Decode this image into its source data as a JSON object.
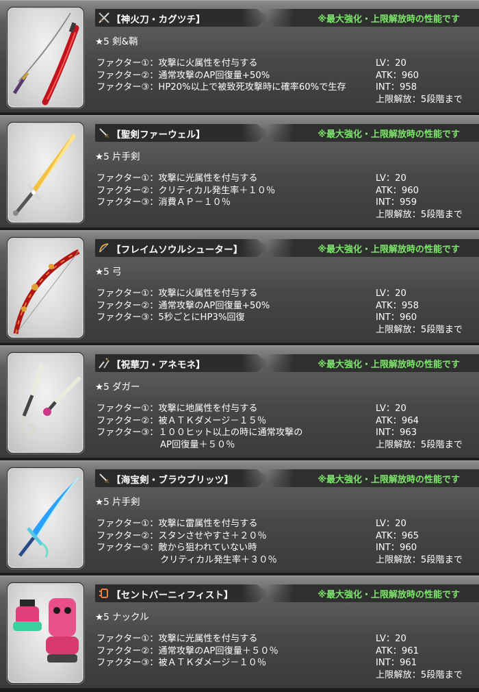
{
  "notice_text": "※最大強化・上限解放時の性能です",
  "items": [
    {
      "name": "【神火刀・カグツチ】",
      "type_icon": "crossed-swords-icon",
      "rarity": "★5 剣&鞘",
      "factors": [
        "ファクター①：攻撃に火属性を付与する",
        "ファクター②：通常攻撃のAP回復量+50%",
        "ファクター③：HP20%以上で被致死攻撃時に確率60%で生存"
      ],
      "factor3_cont": "",
      "lv": "LV：20",
      "atk": "ATK：960",
      "int": "INT：958",
      "limit": "上限解放：5段階まで"
    },
    {
      "name": "【聖剣ファーウェル】",
      "type_icon": "one-hand-sword-icon",
      "rarity": "★5 片手剣",
      "factors": [
        "ファクター①：攻撃に光属性を付与する",
        "ファクター②：クリティカル発生率＋１０％",
        "ファクター③：消費ＡＰ－１０％"
      ],
      "factor3_cont": "",
      "lv": "LV：20",
      "atk": "ATK：960",
      "int": "INT：959",
      "limit": "上限解放：5段階まで"
    },
    {
      "name": "【フレイムソウルシューター】",
      "type_icon": "bow-icon",
      "rarity": "★5 弓",
      "factors": [
        "ファクター①：攻撃に火属性を付与する",
        "ファクター②：通常攻撃のAP回復量+50%",
        "ファクター③：5秒ごとにHP3%回復"
      ],
      "factor3_cont": "",
      "lv": "LV：20",
      "atk": "ATK：958",
      "int": "INT：960",
      "limit": "上限解放：5段階まで"
    },
    {
      "name": "【祝華刀・アネモネ】",
      "type_icon": "dagger-icon",
      "rarity": "★5 ダガー",
      "factors": [
        "ファクター①：攻撃に地属性を付与する",
        "ファクター②：被ＡＴＫダメージ－１５％",
        "ファクター③：１００ヒット以上の時に通常攻撃の"
      ],
      "factor3_cont": "AP回復量＋５０％",
      "lv": "LV：20",
      "atk": "ATK：964",
      "int": "INT：963",
      "limit": "上限解放：5段階まで"
    },
    {
      "name": "【海宝剣・ブラウブリッツ】",
      "type_icon": "one-hand-sword-icon",
      "rarity": "★5 片手剣",
      "factors": [
        "ファクター①：攻撃に雷属性を付与する",
        "ファクター②：スタンさせやすさ＋２０％",
        "ファクター③：敵から狙われていない時"
      ],
      "factor3_cont": "クリティカル発生率＋３０％",
      "lv": "LV：20",
      "atk": "ATK：965",
      "int": "INT：960",
      "limit": "上限解放：5段階まで"
    },
    {
      "name": "【セントバーニィフィスト】",
      "type_icon": "knuckle-icon",
      "rarity": "★5 ナックル",
      "factors": [
        "ファクター①：攻撃に光属性を付与する",
        "ファクター②：通常攻撃のAP回復量＋５０％",
        "ファクター③：被ＡＴＫダメージ－１０％"
      ],
      "factor3_cont": "",
      "lv": "LV：20",
      "atk": "ATK：961",
      "int": "INT：961",
      "limit": "上限解放：5段階まで"
    }
  ]
}
